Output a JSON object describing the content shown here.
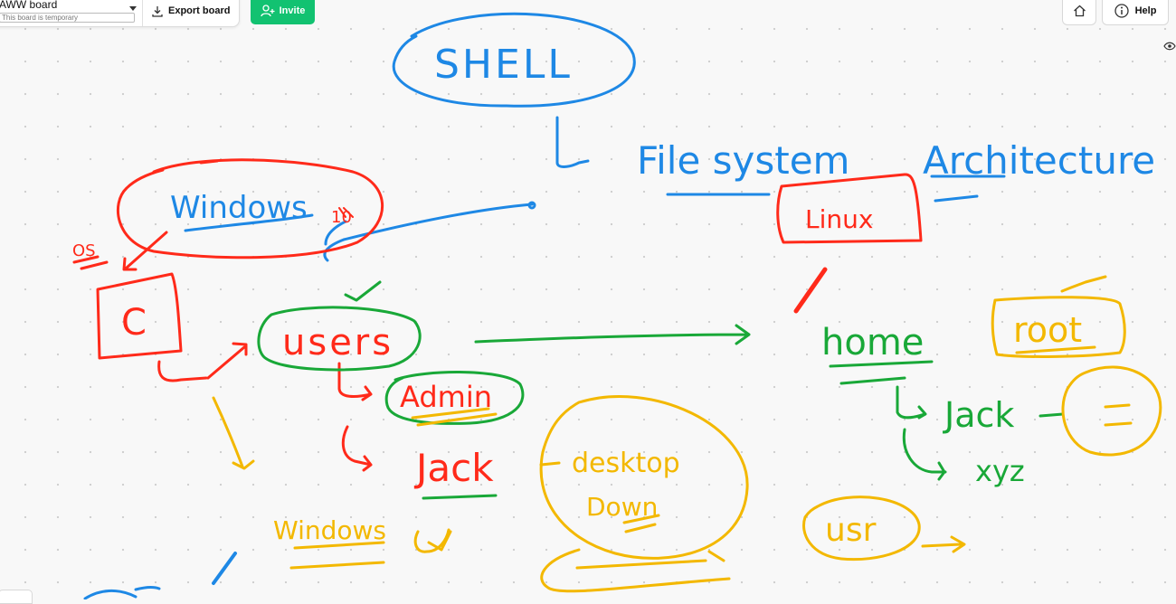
{
  "toolbar": {
    "board_title": "AWW board",
    "temp_badge": "This board is temporary",
    "export_label": "Export board",
    "invite_label": "Invite",
    "help_label": "Help"
  },
  "canvas": {
    "words": {
      "shell": "SHELL",
      "filesystem": "File system",
      "architecture": "Architecture",
      "windows": "Windows",
      "ten": "10",
      "os": "OS",
      "c_drive": "C",
      "users": "users",
      "admin": "Admin",
      "jack": "Jack",
      "desktop": "desktop",
      "down": "Down",
      "windows_lower": "Windows",
      "linux": "Linux",
      "home": "home",
      "root": "root",
      "jack_home": "Jack",
      "xyz": "xyz",
      "usr": "usr"
    },
    "colors": {
      "blue": "#1e88e5",
      "red": "#ff2a1a",
      "green": "#19a838",
      "yellow": "#f3b800"
    }
  }
}
